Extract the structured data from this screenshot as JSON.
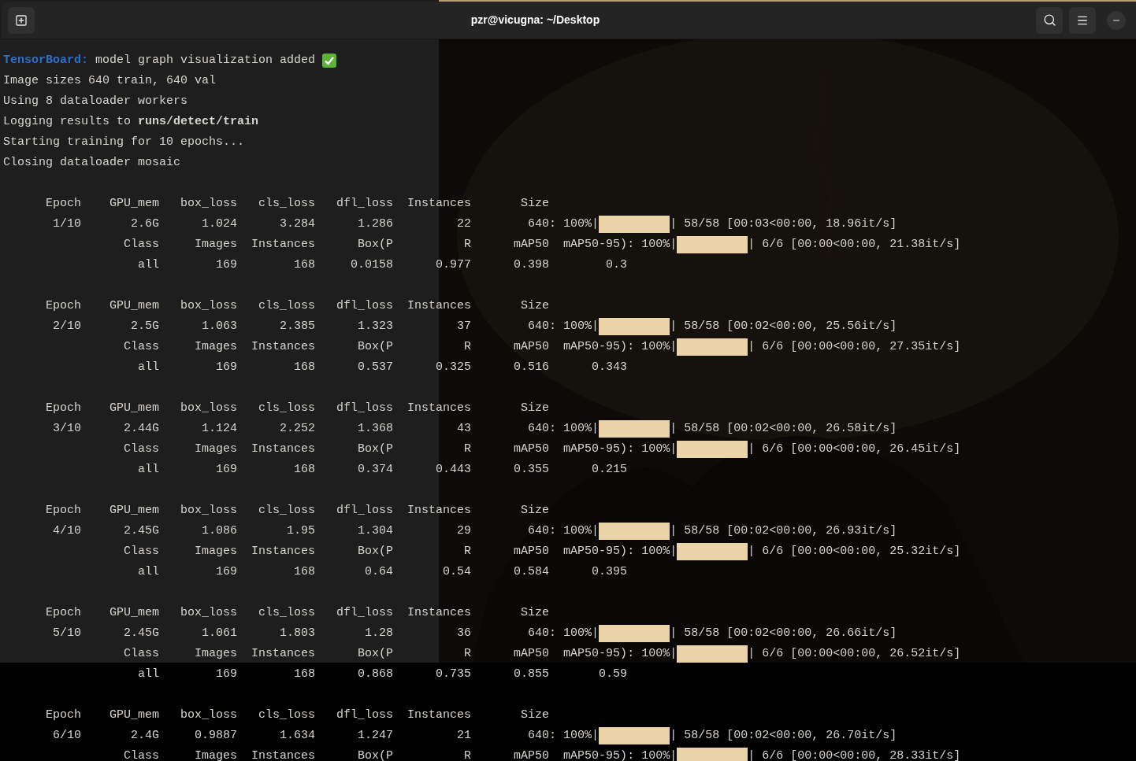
{
  "window": {
    "title": "pzr@vicugna: ~/Desktop"
  },
  "log": [
    {
      "label": "TensorBoard:",
      "text": "model graph visualization added",
      "check": true
    },
    {
      "text": "Image sizes 640 train, 640 val",
      "check": false
    },
    {
      "text": "Using 8 dataloader workers",
      "check": false
    },
    {
      "text": "Logging results to",
      "bold": "runs/detect/train",
      "check": false
    },
    {
      "text": "Starting training for 10 epochs...",
      "check": false
    },
    {
      "text": "Closing dataloader mosaic",
      "check": false
    }
  ],
  "epochs": [
    {
      "train_columns": [
        "Epoch",
        "GPU_mem",
        "box_loss",
        "cls_loss",
        "dfl_loss",
        "Instances",
        "Size"
      ],
      "train_values": [
        "1/10",
        "2.6G",
        "1.024",
        "3.284",
        "1.286",
        "22",
        "640"
      ],
      "train_progress": {
        "prefix": ": 100%|",
        "level": 1,
        "suffix": "| 58/58 [00:03<00:00, 18.96it/s]"
      },
      "val_columns": [
        "Class",
        "Images",
        "Instances",
        "Box(P",
        "R",
        "mAP50"
      ],
      "val_progress": {
        "prefix": "  mAP50-95): 100%|",
        "level": 1,
        "suffix": "| 6/6 [00:00<00:00, 21.38it/s]"
      },
      "val_values": [
        "all",
        "169",
        "168",
        "0.0158",
        "0.977",
        "0.398",
        "0.3"
      ]
    },
    {
      "train_columns": [
        "Epoch",
        "GPU_mem",
        "box_loss",
        "cls_loss",
        "dfl_loss",
        "Instances",
        "Size"
      ],
      "train_values": [
        "2/10",
        "2.5G",
        "1.063",
        "2.385",
        "1.323",
        "37",
        "640"
      ],
      "train_progress": {
        "prefix": ": 100%|",
        "level": 1,
        "suffix": "| 58/58 [00:02<00:00, 25.56it/s]"
      },
      "val_columns": [
        "Class",
        "Images",
        "Instances",
        "Box(P",
        "R",
        "mAP50"
      ],
      "val_progress": {
        "prefix": "  mAP50-95): 100%|",
        "level": 1,
        "suffix": "| 6/6 [00:00<00:00, 27.35it/s]"
      },
      "val_values": [
        "all",
        "169",
        "168",
        "0.537",
        "0.325",
        "0.516",
        "0.343"
      ]
    },
    {
      "train_columns": [
        "Epoch",
        "GPU_mem",
        "box_loss",
        "cls_loss",
        "dfl_loss",
        "Instances",
        "Size"
      ],
      "train_values": [
        "3/10",
        "2.44G",
        "1.124",
        "2.252",
        "1.368",
        "43",
        "640"
      ],
      "train_progress": {
        "prefix": ": 100%|",
        "level": 1,
        "suffix": "| 58/58 [00:02<00:00, 26.58it/s]"
      },
      "val_columns": [
        "Class",
        "Images",
        "Instances",
        "Box(P",
        "R",
        "mAP50"
      ],
      "val_progress": {
        "prefix": "  mAP50-95): 100%|",
        "level": 1,
        "suffix": "| 6/6 [00:00<00:00, 26.45it/s]"
      },
      "val_values": [
        "all",
        "169",
        "168",
        "0.374",
        "0.443",
        "0.355",
        "0.215"
      ]
    },
    {
      "train_columns": [
        "Epoch",
        "GPU_mem",
        "box_loss",
        "cls_loss",
        "dfl_loss",
        "Instances",
        "Size"
      ],
      "train_values": [
        "4/10",
        "2.45G",
        "1.086",
        "1.95",
        "1.304",
        "29",
        "640"
      ],
      "train_progress": {
        "prefix": ": 100%|",
        "level": 1,
        "suffix": "| 58/58 [00:02<00:00, 26.93it/s]"
      },
      "val_columns": [
        "Class",
        "Images",
        "Instances",
        "Box(P",
        "R",
        "mAP50"
      ],
      "val_progress": {
        "prefix": "  mAP50-95): 100%|",
        "level": 1,
        "suffix": "| 6/6 [00:00<00:00, 25.32it/s]"
      },
      "val_values": [
        "all",
        "169",
        "168",
        "0.64",
        "0.54",
        "0.584",
        "0.395"
      ]
    },
    {
      "train_columns": [
        "Epoch",
        "GPU_mem",
        "box_loss",
        "cls_loss",
        "dfl_loss",
        "Instances",
        "Size"
      ],
      "train_values": [
        "5/10",
        "2.45G",
        "1.061",
        "1.803",
        "1.28",
        "36",
        "640"
      ],
      "train_progress": {
        "prefix": ": 100%|",
        "level": 1,
        "suffix": "| 58/58 [00:02<00:00, 26.66it/s]"
      },
      "val_columns": [
        "Class",
        "Images",
        "Instances",
        "Box(P",
        "R",
        "mAP50"
      ],
      "val_progress": {
        "prefix": "  mAP50-95): 100%|",
        "level": 1,
        "suffix": "| 6/6 [00:00<00:00, 26.52it/s]"
      },
      "val_values": [
        "all",
        "169",
        "168",
        "0.868",
        "0.735",
        "0.855",
        "0.59"
      ]
    },
    {
      "train_columns": [
        "Epoch",
        "GPU_mem",
        "box_loss",
        "cls_loss",
        "dfl_loss",
        "Instances",
        "Size"
      ],
      "train_values": [
        "6/10",
        "2.4G",
        "0.9887",
        "1.634",
        "1.247",
        "21",
        "640"
      ],
      "train_progress": {
        "prefix": ": 100%|",
        "level": 1,
        "suffix": "| 58/58 [00:02<00:00, 26.70it/s]"
      },
      "val_columns": [
        "Class",
        "Images",
        "Instances",
        "Box(P",
        "R",
        "mAP50"
      ],
      "val_progress": {
        "prefix": "  mAP50-95): 100%|",
        "level": 1,
        "suffix": "| 6/6 [00:00<00:00, 28.33it/s]"
      }
    }
  ]
}
